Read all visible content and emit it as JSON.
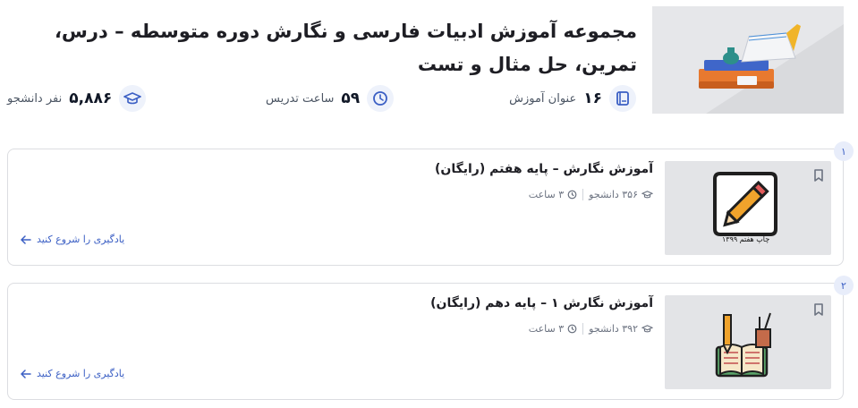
{
  "course": {
    "title": "مجموعه آموزش ادبیات فارسی و نگارش دوره متوسطه – درس، تمرین، حل مثال و تست",
    "image_icon": "book-inkpot-quill-illustration"
  },
  "stats": {
    "lessons": {
      "value": "۱۶",
      "label": "عنوان آموزش",
      "icon": "book-icon"
    },
    "hours": {
      "value": "۵۹",
      "label": "ساعت تدریس",
      "icon": "clock-icon"
    },
    "students": {
      "value": "۵,۸۸۶",
      "label": "نفر دانشجو",
      "icon": "graduation-cap-icon"
    }
  },
  "lessons": [
    {
      "index": "۱",
      "title": "آموزش نگارش – پایه هفتم (رایگان)",
      "students": "۳۵۶ دانشجو",
      "duration": "۳ ساعت",
      "thumb_caption": "چاپ هفتم ۱۳۹۹",
      "thumb_icon": "pencil-paper-illustration",
      "cta": "یادگیری را شروع کنید"
    },
    {
      "index": "۲",
      "title": "آموزش نگارش ۱ – پایه دهم (رایگان)",
      "students": "۳۹۲ دانشجو",
      "duration": "۳ ساعت",
      "thumb_icon": "open-book-stationery-illustration",
      "cta": "یادگیری را شروع کنید"
    }
  ],
  "colors": {
    "accent": "#3b5fc4",
    "text": "#1e1e24",
    "border": "#dcdde1",
    "icon_bg": "#eef2fb"
  }
}
